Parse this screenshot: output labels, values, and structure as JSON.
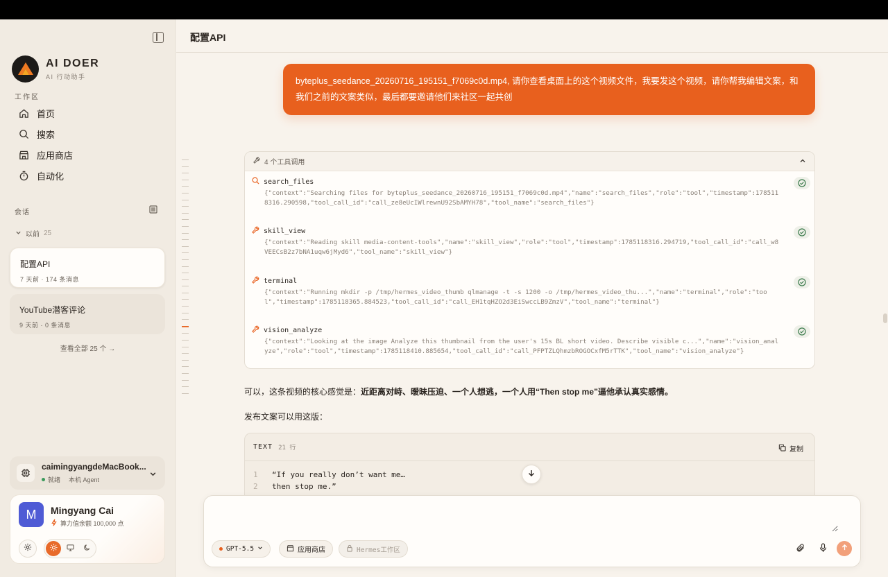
{
  "brand": {
    "name": "AI DOER",
    "subtitle": "AI 行动助手"
  },
  "sidebar": {
    "workspace_label": "工作区",
    "nav": [
      {
        "label": "首页",
        "icon": "home-icon"
      },
      {
        "label": "搜索",
        "icon": "search-icon"
      },
      {
        "label": "应用商店",
        "icon": "store-icon"
      },
      {
        "label": "自动化",
        "icon": "timer-icon"
      }
    ],
    "conversations_label": "会话",
    "earlier_label": "以前",
    "earlier_count": "25",
    "conversations": [
      {
        "title": "配置API",
        "meta": "7 天前 · 174 条消息",
        "active": true
      },
      {
        "title": "YouTube潜客评论",
        "meta": "9 天前 · 0 条消息",
        "active": false
      }
    ],
    "see_all": "查看全部 25 个 →",
    "machine": {
      "name": "caimingyangdeMacBook...",
      "status": "就绪",
      "type": "本机 Agent"
    },
    "user": {
      "initial": "M",
      "name": "Mingyang Cai",
      "credit": "算力值余额 100,000 点"
    }
  },
  "main": {
    "title": "配置API",
    "user_message": "byteplus_seedance_20260716_195151_f7069c0d.mp4, 请你查看桌面上的这个视频文件，我要发这个视频，请你帮我编辑文案，和我们之前的文案类似，最后都要邀请他们来社区一起共创",
    "tools_header": "4 个工具调用",
    "tools": [
      {
        "name": "search_files",
        "icon": "search-icon",
        "json": "{\"context\":\"Searching files for byteplus_seedance_20260716_195151_f7069c0d.mp4\",\"name\":\"search_files\",\"role\":\"tool\",\"timestamp\":1785118316.290598,\"tool_call_id\":\"call_ze8eUcIWlrewnU92SbAMYH78\",\"tool_name\":\"search_files\"}"
      },
      {
        "name": "skill_view",
        "icon": "wrench-icon",
        "json": "{\"context\":\"Reading skill media-content-tools\",\"name\":\"skill_view\",\"role\":\"tool\",\"timestamp\":1785118316.294719,\"tool_call_id\":\"call_w8VEECsB2z7bNA1uqw6jMyd6\",\"tool_name\":\"skill_view\"}"
      },
      {
        "name": "terminal",
        "icon": "wrench-icon",
        "json": "{\"context\":\"Running mkdir -p /tmp/hermes_video_thumb qlmanage -t -s 1200 -o /tmp/hermes_video_thu...\",\"name\":\"terminal\",\"role\":\"tool\",\"timestamp\":1785118365.884523,\"tool_call_id\":\"call_EH1tqHZO2d3EiSwccLB9ZmzV\",\"tool_name\":\"terminal\"}"
      },
      {
        "name": "vision_analyze",
        "icon": "wrench-icon",
        "json": "{\"context\":\"Looking at the image Analyze this thumbnail from the user's 15s BL short video. Describe visible c...\",\"name\":\"vision_analyze\",\"role\":\"tool\",\"timestamp\":1785118410.885654,\"tool_call_id\":\"call_PFPTZLQhmzbROGOCxfM5rTTK\",\"tool_name\":\"vision_analyze\"}"
      }
    ],
    "assistant_intro": "可以，这条视频的核心感觉是：",
    "assistant_bold": "近距离对峙、暧昧压迫、一个人想逃，一个人用“Then stop me”逼他承认真实感情。",
    "assistant_line2": "发布文案可以用这版：",
    "code": {
      "lang": "TEXT",
      "lines_label": "21 行",
      "copy_label": "复制",
      "lines": [
        {
          "n": "1",
          "text": "“If you really don’t want me…"
        },
        {
          "n": "2",
          "text": "then stop me.”"
        }
      ]
    }
  },
  "composer": {
    "placeholder": "",
    "model": "GPT-5.5",
    "store": "应用商店",
    "workspace": "Hermes工作区"
  },
  "colors": {
    "accent": "#e8601e",
    "sidebar_bg": "#f1ebe2",
    "main_bg": "#f8f3ec"
  }
}
